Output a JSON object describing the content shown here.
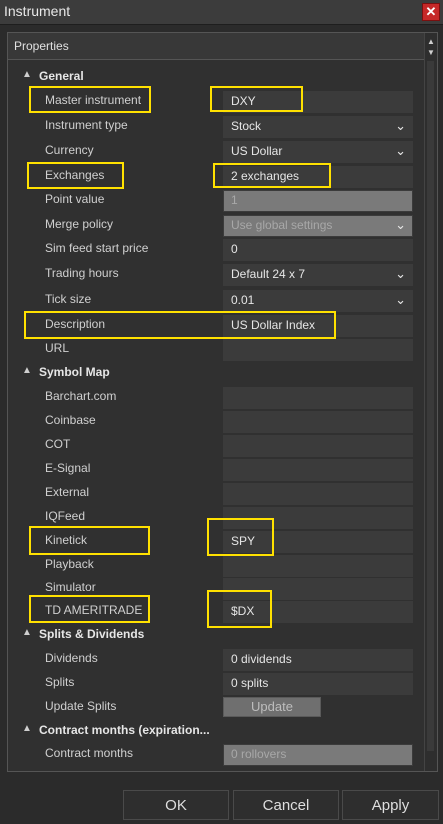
{
  "window": {
    "title": "Instrument",
    "close_glyph": "✕"
  },
  "panel": {
    "header": "Properties"
  },
  "general": {
    "title": "General",
    "master_instrument_label": "Master instrument",
    "master_instrument_value": "DXY",
    "instrument_type_label": "Instrument type",
    "instrument_type_value": "Stock",
    "currency_label": "Currency",
    "currency_value": "US Dollar",
    "exchanges_label": "Exchanges",
    "exchanges_value": "2 exchanges",
    "point_value_label": "Point value",
    "point_value_value": "1",
    "merge_policy_label": "Merge policy",
    "merge_policy_value": "Use global settings",
    "sim_feed_label": "Sim feed start price",
    "sim_feed_value": "0",
    "trading_hours_label": "Trading hours",
    "trading_hours_value": "Default 24 x 7",
    "tick_size_label": "Tick size",
    "tick_size_value": "0.01",
    "description_label": "Description",
    "description_value": "US Dollar Index",
    "url_label": "URL",
    "url_value": ""
  },
  "symbol_map": {
    "title": "Symbol Map",
    "barchart": "Barchart.com",
    "coinbase": "Coinbase",
    "cot": "COT",
    "esignal": "E-Signal",
    "external": "External",
    "iqfeed": "IQFeed",
    "kinetick": "Kinetick",
    "kinetick_value": "SPY",
    "playback": "Playback",
    "simulator": "Simulator",
    "tdameritrade": "TD AMERITRADE",
    "tdameritrade_value": "$DX"
  },
  "splits": {
    "title": "Splits & Dividends",
    "dividends_label": "Dividends",
    "dividends_value": "0 dividends",
    "splits_label": "Splits",
    "splits_value": "0 splits",
    "update_label": "Update Splits",
    "update_button": "Update"
  },
  "contract": {
    "title": "Contract months (expiration...",
    "months_label": "Contract months",
    "months_value": "0 rollovers"
  },
  "footer": {
    "ok": "OK",
    "cancel": "Cancel",
    "apply": "Apply"
  },
  "colors": {
    "highlight": "#ffe100",
    "close": "#c62828"
  }
}
